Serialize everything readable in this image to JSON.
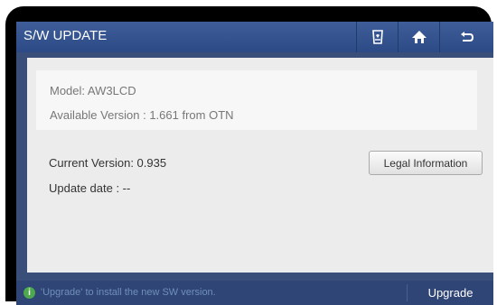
{
  "header": {
    "title": "S/W UPDATE",
    "buttons": [
      "device-care-icon",
      "home-icon",
      "back-icon"
    ]
  },
  "info": {
    "model": "Model: AW3LCD",
    "available_version": "Available Version : 1.661 from OTN"
  },
  "current": {
    "version": "Current Version: 0.935",
    "update_date": "Update date : --"
  },
  "legal_button": "Legal Information",
  "footer": {
    "hint": "'Upgrade' to install the new SW version.",
    "upgrade_label": "Upgrade",
    "info_glyph": "i"
  },
  "colors": {
    "title_bar": "#2c4a86",
    "background": "#3a4e7a",
    "panel": "#ececec",
    "info_icon": "#4ea84e"
  }
}
